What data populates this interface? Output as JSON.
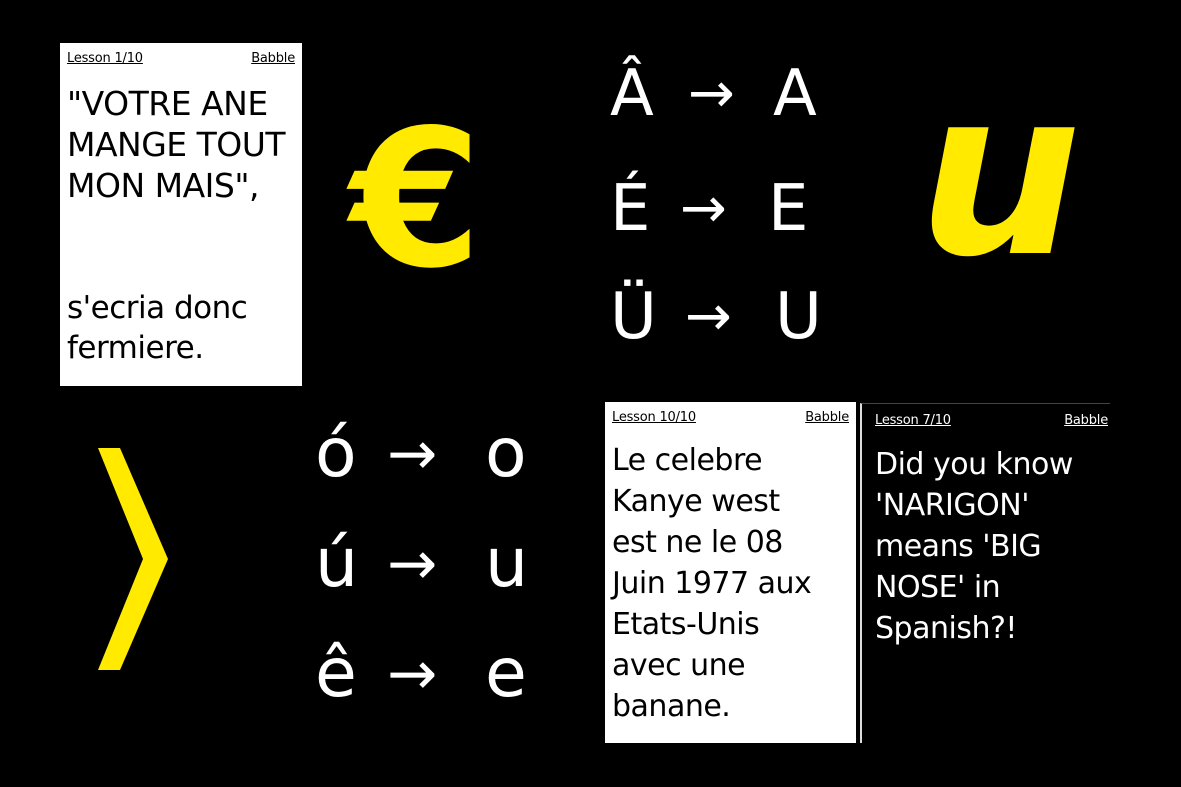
{
  "card_1": {
    "lesson": "Lesson 1/10",
    "brand": "Babble",
    "quote_lines": [
      "\"VOTRE ANE",
      "MANGE TOUT",
      "MON MAIS\","
    ],
    "tail_lines": [
      "s'ecria donc",
      "fermiere."
    ]
  },
  "card_2": {
    "lesson": "Lesson 10/10",
    "brand": "Babble",
    "lines": [
      "Le celebre",
      "Kanye west",
      "est ne le 08",
      "Juin 1977 aux",
      "Etats-Unis",
      "avec une",
      "banane."
    ]
  },
  "card_3": {
    "lesson": "Lesson 7/10",
    "brand": "Babble",
    "lines": [
      "Did you know",
      "'NARIGON'",
      "means 'BIG",
      "NOSE' in",
      "Spanish?!"
    ]
  },
  "glyph_map_upper": [
    {
      "from": "Â",
      "arrow": "→",
      "to": "A"
    },
    {
      "from": "É",
      "arrow": "→",
      "to": "E"
    },
    {
      "from": "Ü",
      "arrow": "→",
      "to": "U"
    }
  ],
  "glyph_map_lower": [
    {
      "from": "ó",
      "arrow": "→",
      "to": "o"
    },
    {
      "from": "ú",
      "arrow": "→",
      "to": "u"
    },
    {
      "from": "ê",
      "arrow": "→",
      "to": "e"
    }
  ],
  "big_glyphs": {
    "euro": "€",
    "u": "u",
    "chevron": "›"
  },
  "colors": {
    "background": "#000000",
    "accent": "#ffea00",
    "card": "#ffffff"
  }
}
